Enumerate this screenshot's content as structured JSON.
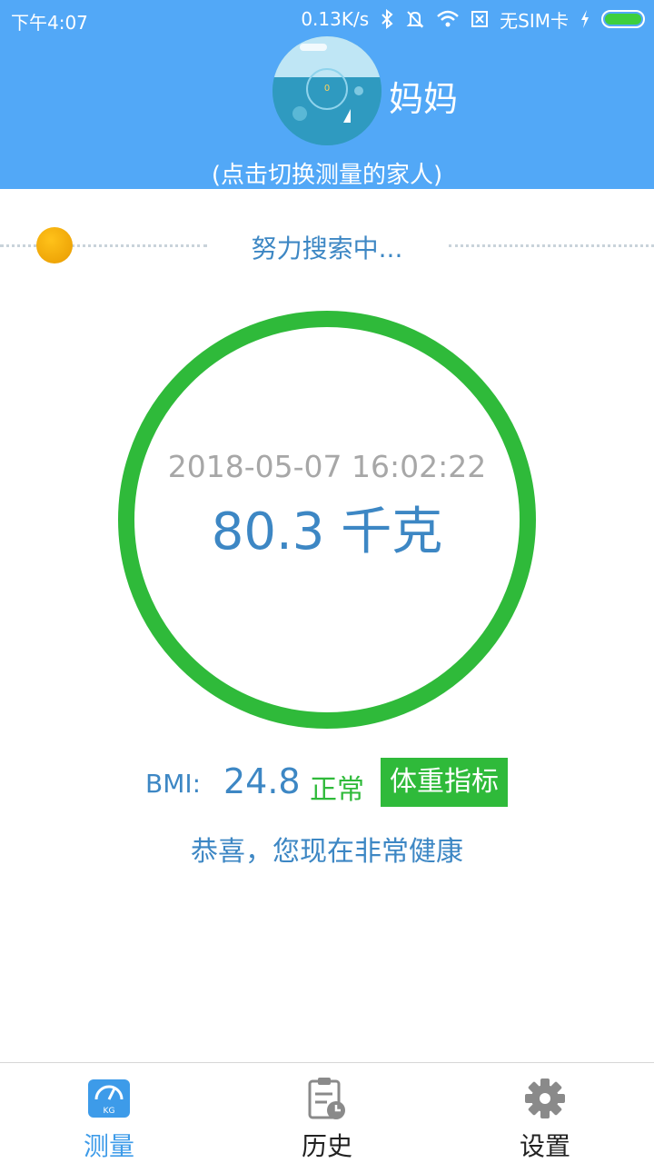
{
  "status_bar": {
    "time": "下午4:07",
    "network_speed": "0.13K/s",
    "sim_status": "无SIM卡",
    "icons": [
      "bluetooth-icon",
      "mute-bell-icon",
      "wifi-icon",
      "no-sim-icon",
      "charging-icon",
      "battery-icon"
    ]
  },
  "header": {
    "member_name": "妈妈",
    "switch_hint": "(点击切换测量的家人)",
    "avatar": "avatar-image"
  },
  "search": {
    "status_text": "努力搜索中..."
  },
  "measurement": {
    "timestamp": "2018-05-07 16:02:22",
    "weight": "80.3 千克"
  },
  "bmi": {
    "label": "BMI:",
    "value": "24.8",
    "status": "正常",
    "index_button": "体重指标"
  },
  "health_message": "恭喜，您现在非常健康",
  "tabs": [
    {
      "label": "测量",
      "icon": "scale-icon",
      "active": true
    },
    {
      "label": "历史",
      "icon": "history-icon",
      "active": false
    },
    {
      "label": "设置",
      "icon": "gear-icon",
      "active": false
    }
  ],
  "colors": {
    "header_bg": "#52a8f7",
    "accent_blue": "#3d87c4",
    "ring_green": "#2fba3a",
    "tab_active": "#3d9be9"
  }
}
